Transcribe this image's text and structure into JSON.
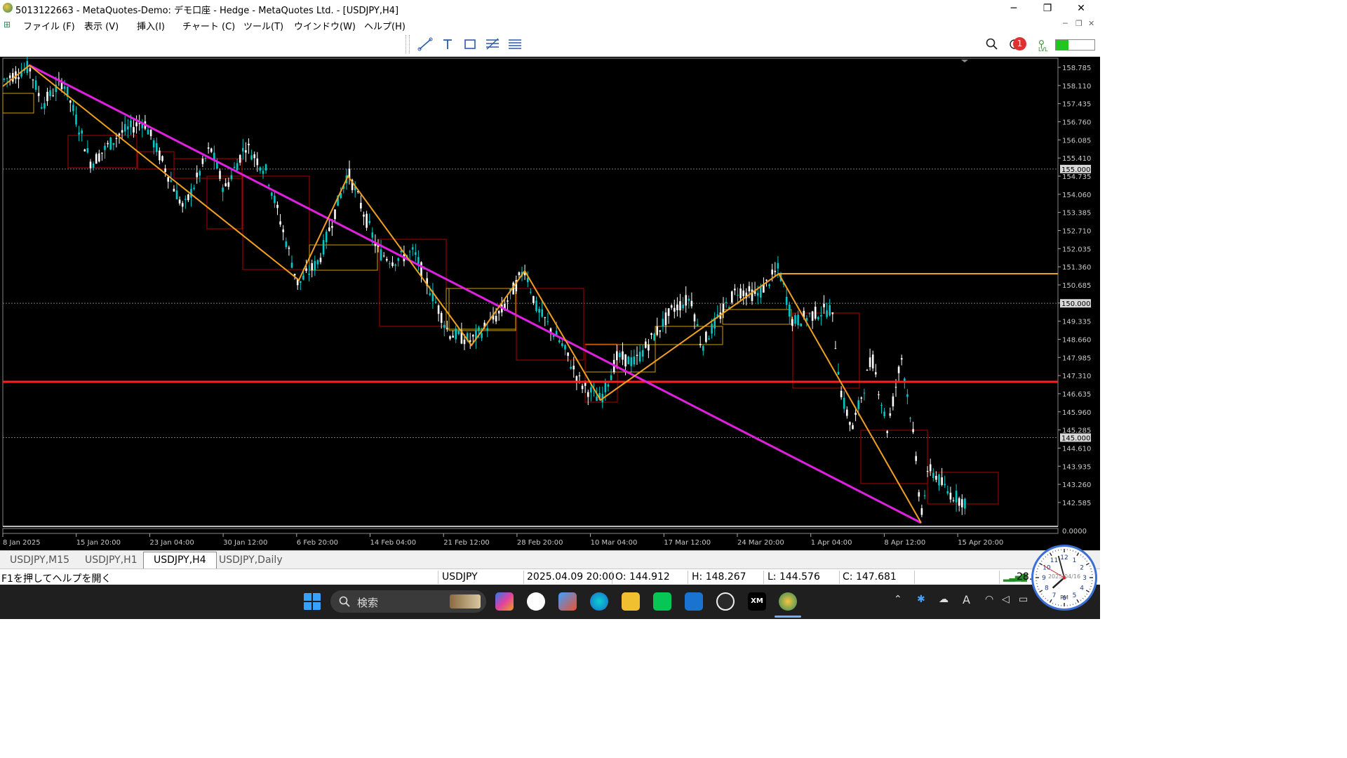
{
  "window": {
    "title": "5013122663 - MetaQuotes-Demo: デモ口座 - Hedge - MetaQuotes Ltd. - [USDJPY,H4]",
    "minimize": "─",
    "maximize": "❐",
    "close": "✕"
  },
  "menu": {
    "items": [
      "ファイル (F)",
      "表示 (V)",
      "挿入(I)",
      "チャート (C)",
      "ツール(T)",
      "ウインドウ(W)",
      "ヘルプ(H)"
    ],
    "mdi_minimize": "─",
    "mdi_restore": "❐",
    "mdi_close": "✕"
  },
  "toolbar": {
    "icons": [
      "trendline-icon",
      "text-icon",
      "rectangle-icon",
      "fibonacci-icon",
      "channel-icon"
    ],
    "notification_count": "1",
    "signal_label": "LVL"
  },
  "chart": {
    "symbol": "USDJPY",
    "timeframe": "H4",
    "price_labels": [
      "158.785",
      "158.110",
      "157.435",
      "156.760",
      "156.085",
      "155.410",
      "154.735",
      "154.060",
      "153.385",
      "152.710",
      "152.035",
      "151.360",
      "150.685",
      "150.010",
      "149.335",
      "148.660",
      "147.985",
      "147.310",
      "146.635",
      "145.960",
      "145.285",
      "144.610",
      "143.935",
      "143.260",
      "142.585"
    ],
    "highlight_labels": [
      "155.000",
      "150.000",
      "145.000"
    ],
    "sub_label": "0.0000",
    "time_labels": [
      "8 Jan 2025",
      "15 Jan 20:00",
      "23 Jan 04:00",
      "30 Jan 12:00",
      "6 Feb 20:00",
      "14 Feb 04:00",
      "21 Feb 12:00",
      "28 Feb 20:00",
      "10 Mar 04:00",
      "17 Mar 12:00",
      "24 Mar 20:00",
      "1 Apr 04:00",
      "8 Apr 12:00",
      "15 Apr 20:00"
    ],
    "colors": {
      "bull": "#00c8c8",
      "bear": "#ffffff",
      "magenta": "#e020e0",
      "orange": "#f0a020",
      "red": "#ff2020",
      "box_red": "#b00000",
      "box_yellow": "#d0a000"
    }
  },
  "tabs": [
    "USDJPY,M15",
    "USDJPY,H1",
    "USDJPY,H4",
    "USDJPY,Daily"
  ],
  "active_tab": "USDJPY,H4",
  "status": {
    "help": "F1を押してヘルプを開く",
    "symbol": "USDJPY",
    "datetime": "2025.04.09 20:00",
    "open": "O: 144.912",
    "high": "H: 148.267",
    "low": "L: 144.576",
    "close": "C: 147.681",
    "signal": "28."
  },
  "taskbar": {
    "search_label": "検索",
    "tray_lang": "A",
    "clock_date": "2025/04/16",
    "clock_pm": "PM"
  }
}
